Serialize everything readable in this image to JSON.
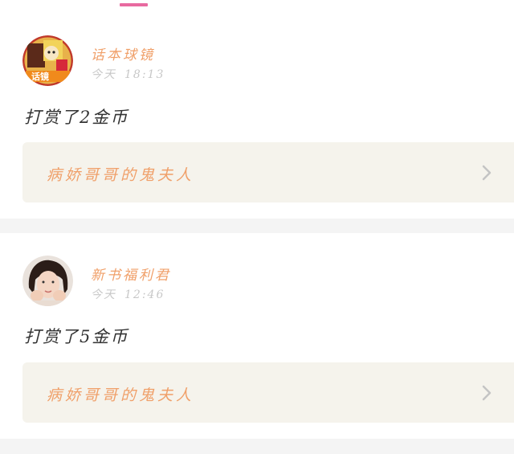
{
  "feed": {
    "items": [
      {
        "user": {
          "name": "话本球镜",
          "avatar_icon": "avatar-cartoon-icon"
        },
        "date_label": "今天",
        "time": "18:13",
        "message": "打赏了2金币",
        "book": {
          "title": "病娇哥哥的鬼夫人",
          "chevron_icon": "chevron-right-icon"
        }
      },
      {
        "user": {
          "name": "新书福利君",
          "avatar_icon": "avatar-photo-icon"
        },
        "date_label": "今天",
        "time": "12:46",
        "message": "打赏了5金币",
        "book": {
          "title": "病娇哥哥的鬼夫人",
          "chevron_icon": "chevron-right-icon"
        }
      }
    ]
  },
  "colors": {
    "accent_pink": "#e86aa0",
    "name_orange": "#f0a06a",
    "card_bg": "#f5f3ec",
    "separator": "#f4f4f4"
  }
}
